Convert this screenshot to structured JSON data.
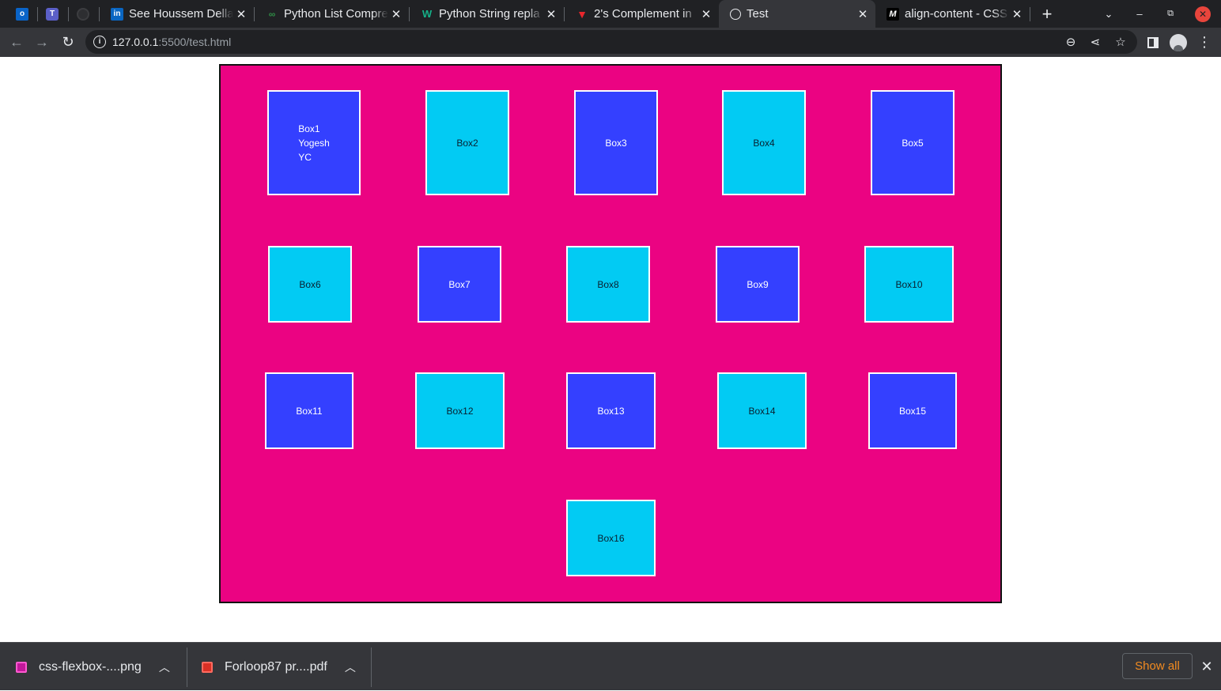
{
  "browser": {
    "tabs": [
      {
        "title": "See Houssem Della",
        "favicon": "linkedin-icon",
        "active": false
      },
      {
        "title": "Python List Compre",
        "favicon": "geeksforgeeks-icon",
        "active": false
      },
      {
        "title": "Python String repla",
        "favicon": "w3resource-icon",
        "active": false
      },
      {
        "title": "2's Complement in",
        "favicon": "vcard-icon",
        "active": false
      },
      {
        "title": "Test",
        "favicon": "globe-icon",
        "active": true
      },
      {
        "title": "align-content - CSS",
        "favicon": "mdn-icon",
        "active": false
      }
    ],
    "pinned_tabs": [
      "outlook-icon",
      "teams-icon",
      "github-icon"
    ],
    "url_host": "127.0.0.1",
    "url_rest": ":5500/test.html"
  },
  "page": {
    "container_color": "#eb0382",
    "box_colors": {
      "blue": "#3440ff",
      "cyan": "#02cbf3"
    },
    "boxes": [
      {
        "lines": [
          "Box1",
          "Yogesh",
          "YC"
        ],
        "color": "blue"
      },
      {
        "lines": [
          "Box2"
        ],
        "color": "cyan"
      },
      {
        "lines": [
          "Box3"
        ],
        "color": "blue"
      },
      {
        "lines": [
          "Box4"
        ],
        "color": "cyan"
      },
      {
        "lines": [
          "Box5"
        ],
        "color": "blue"
      },
      {
        "lines": [
          "Box6"
        ],
        "color": "cyan"
      },
      {
        "lines": [
          "Box7"
        ],
        "color": "blue"
      },
      {
        "lines": [
          "Box8"
        ],
        "color": "cyan"
      },
      {
        "lines": [
          "Box9"
        ],
        "color": "blue"
      },
      {
        "lines": [
          "Box10"
        ],
        "color": "cyan"
      },
      {
        "lines": [
          "Box11"
        ],
        "color": "blue"
      },
      {
        "lines": [
          "Box12"
        ],
        "color": "cyan"
      },
      {
        "lines": [
          "Box13"
        ],
        "color": "blue"
      },
      {
        "lines": [
          "Box14"
        ],
        "color": "cyan"
      },
      {
        "lines": [
          "Box15"
        ],
        "color": "blue"
      },
      {
        "lines": [
          "Box16"
        ],
        "color": "cyan"
      }
    ]
  },
  "downloads": {
    "items": [
      {
        "name": "css-flexbox-....png",
        "icon": "image-file-icon"
      },
      {
        "name": "Forloop87 pr....pdf",
        "icon": "pdf-file-icon"
      }
    ],
    "show_all": "Show all"
  }
}
